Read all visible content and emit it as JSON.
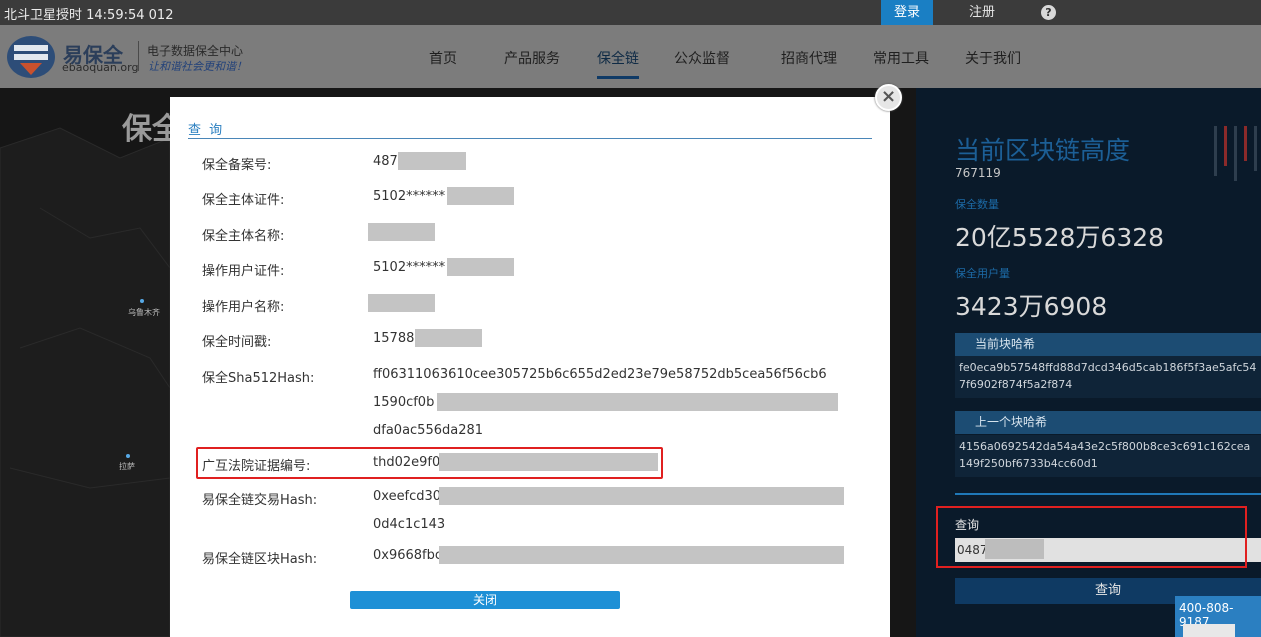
{
  "topbar": {
    "time_text": "北斗卫星授时 14:59:54 012",
    "login": "登录",
    "register": "注册",
    "help": "?"
  },
  "logo": {
    "name": "易保全",
    "domain": "ebaoquan.org",
    "center_name": "电子数据保全中心",
    "slogan": "让和谐社会更和谐！"
  },
  "nav": {
    "items": [
      "首页",
      "产品服务",
      "保全链",
      "公众监督",
      "招商代理",
      "常用工具",
      "关于我们"
    ],
    "active": "保全链"
  },
  "map": {
    "title": "保全",
    "cities": [
      "乌鲁木齐",
      "拉萨"
    ]
  },
  "right_panel": {
    "chain_height_title": "当前区块链高度",
    "chain_height": "767119",
    "count_label": "保全数量",
    "count_value": "20亿5528万6328",
    "users_label": "保全用户量",
    "users_value": "3423万6908",
    "current_hash_label": "当前块哈希",
    "current_hash": "fe0eca9b57548ffd88d7dcd346d5cab186f5f3ae5afc547f6902f874f5a2f874",
    "prev_hash_label": "上一个块哈希",
    "prev_hash": "4156a0692542da54a43e2c5f800b8ce3c691c162cea149f250bf6733b4cc60d1",
    "query_label": "查询",
    "query_value": "0487",
    "query_button": "查询",
    "phone": "400-808-9187"
  },
  "modal": {
    "title": "查 询",
    "close_button": "关闭",
    "close_icon": "×",
    "fields": [
      {
        "label": "保全备案号:",
        "value": "487"
      },
      {
        "label": "保全主体证件:",
        "value": "5102******"
      },
      {
        "label": "保全主体名称:",
        "value": ""
      },
      {
        "label": "操作用户证件:",
        "value": "5102******"
      },
      {
        "label": "操作用户名称:",
        "value": ""
      },
      {
        "label": "保全时间戳:",
        "value": "15788"
      },
      {
        "label": "保全Sha512Hash:",
        "value": "ff06311063610cee305725b6c655d2ed23e79e58752db5cea56f56cb6",
        "value2": "1590cf0b",
        "value3": "dfa0ac556da281"
      },
      {
        "label": "广互法院证据编号:",
        "value": "thd02e9f0"
      },
      {
        "label": "易保全链交易Hash:",
        "value": "0xeefcd30",
        "value2": "0d4c1c143"
      },
      {
        "label": "易保全链区块Hash:",
        "value": "0x9668fbc"
      }
    ]
  }
}
